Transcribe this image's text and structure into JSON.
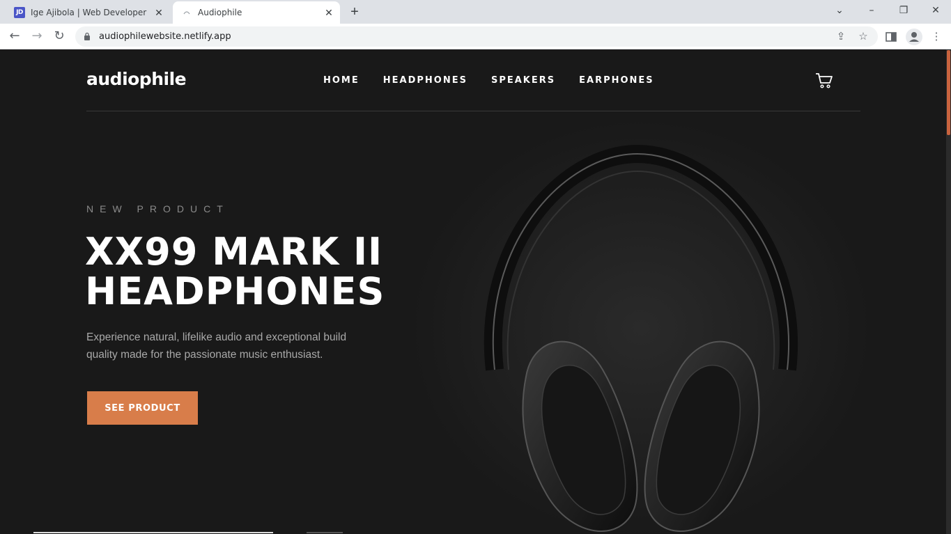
{
  "browser": {
    "tabs": [
      {
        "favicon": "JD",
        "title": "Ige Ajibola | Web Developer",
        "active": false
      },
      {
        "favicon": "audiophile-favicon",
        "title": "Audiophile",
        "active": true
      }
    ],
    "new_tab_label": "+",
    "url": "audiophilewebsite.netlify.app",
    "window_controls": [
      "chevron-down-icon",
      "minimize-icon",
      "restore-icon",
      "close-icon"
    ]
  },
  "site": {
    "logo": "audiophile",
    "nav": [
      "HOME",
      "HEADPHONES",
      "SPEAKERS",
      "EARPHONES"
    ],
    "cart_icon": "cart-icon"
  },
  "hero": {
    "overline": "NEW PRODUCT",
    "title": "XX99 MARK II HEADPHONES",
    "description": "Experience natural, lifelike audio and exceptional build quality made for the passionate music enthusiast.",
    "cta_label": "SEE PRODUCT",
    "image": "headphones-photo"
  },
  "colors": {
    "page_bg": "#191919",
    "accent": "#D87D4A",
    "text_muted": "#A9A9A9"
  }
}
